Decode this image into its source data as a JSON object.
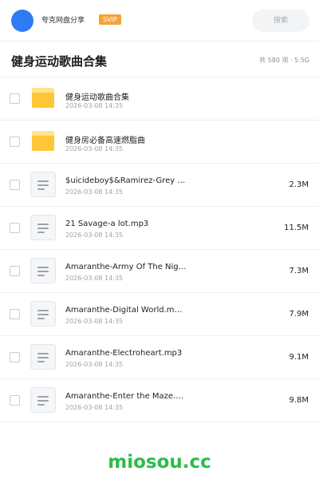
{
  "header": {
    "brand": "夸克网盘分享",
    "badge": "SVIP",
    "search_placeholder": "搜索",
    "accent_color": "#2f7bf6",
    "badge_color": "#f6a23a"
  },
  "folder_title": "健身运动歌曲合集",
  "summary": "共 580 项 · 5.5G",
  "items": [
    {
      "type": "folder",
      "name": "健身运动歌曲合集",
      "date": "2026-03-08 14:35",
      "size": ""
    },
    {
      "type": "folder",
      "name": "健身房必备高速燃脂曲",
      "date": "2026-03-08 14:35",
      "size": ""
    },
    {
      "type": "file",
      "name": "$uicideboy$&Ramirez-Grey …",
      "date": "2026-03-08 14:35",
      "size": "2.3M"
    },
    {
      "type": "file",
      "name": "21 Savage-a lot.mp3",
      "date": "2026-03-08 14:35",
      "size": "11.5M"
    },
    {
      "type": "file",
      "name": "Amaranthe-Army Of The Nig…",
      "date": "2026-03-08 14:35",
      "size": "7.3M"
    },
    {
      "type": "file",
      "name": "Amaranthe-Digital World.m…",
      "date": "2026-03-08 14:35",
      "size": "7.9M"
    },
    {
      "type": "file",
      "name": "Amaranthe-Electroheart.mp3",
      "date": "2026-03-08 14:35",
      "size": "9.1M"
    },
    {
      "type": "file",
      "name": "Amaranthe-Enter the Maze.…",
      "date": "2026-03-08 14:35",
      "size": "9.8M"
    }
  ],
  "watermark": "miosou.cc",
  "icons": {
    "folder": "folder-icon",
    "file": "file-icon",
    "avatar": "avatar-circle"
  }
}
